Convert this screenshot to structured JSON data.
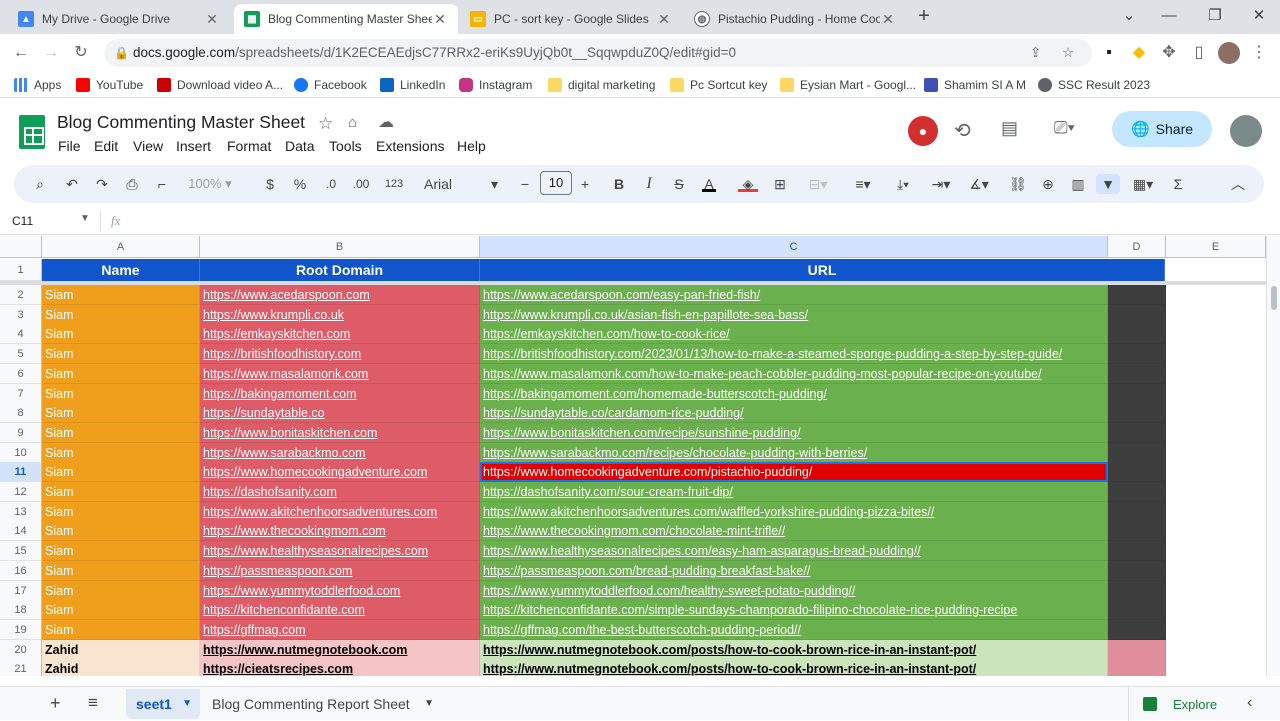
{
  "browser": {
    "tabs": [
      {
        "title": "My Drive - Google Drive",
        "icon": "google-drive-icon",
        "color": "#4285f4"
      },
      {
        "title": "Blog Commenting Master Sheet",
        "icon": "google-sheets-icon",
        "color": "#0f9d58"
      },
      {
        "title": "PC - sort key - Google Slides",
        "icon": "google-slides-icon",
        "color": "#f4b400"
      },
      {
        "title": "Pistachio Pudding - Home Cooki",
        "icon": "web-icon",
        "color": "#5f6368"
      }
    ],
    "url_host": "docs.google.com",
    "url_path": "/spreadsheets/d/1K2ECEAEdjsC77RRx2-eriKs9UyjQb0t__SqqwpduZ0Q/edit#gid=0",
    "bookmarks": [
      {
        "label": "Apps",
        "color": "#4285f4"
      },
      {
        "label": "YouTube",
        "color": "#ff0000"
      },
      {
        "label": "Download video A...",
        "color": "#cc0000"
      },
      {
        "label": "Facebook",
        "color": "#1877f2"
      },
      {
        "label": "LinkedIn",
        "color": "#0a66c2"
      },
      {
        "label": "Instagram",
        "color": "#c13584"
      },
      {
        "label": "digital marketing",
        "color": "#fdd663"
      },
      {
        "label": "Pc Sortcut  key",
        "color": "#fdd663"
      },
      {
        "label": "Eysian Mart - Googl...",
        "color": "#fdd663"
      },
      {
        "label": "Shamim SI A M",
        "color": "#3f51b5"
      },
      {
        "label": "SSC Result 2023",
        "color": "#5f6368"
      }
    ]
  },
  "doc": {
    "title": "Blog Commenting Master Sheet",
    "menus": [
      "File",
      "Edit",
      "View",
      "Insert",
      "Format",
      "Data",
      "Tools",
      "Extensions",
      "Help"
    ],
    "share_label": "Share"
  },
  "toolbar": {
    "zoom": "100%",
    "currency": "$",
    "percent": "%",
    "dec_decrease": ".0",
    "dec_increase": ".00",
    "number_format": "123",
    "font": "Arial",
    "font_size": "10",
    "bold": "B",
    "italic": "I",
    "strike": "S",
    "text_color": "A"
  },
  "formula_bar": {
    "cell_ref": "C11",
    "fx": "fx",
    "content": ""
  },
  "sheet": {
    "columns": [
      "A",
      "B",
      "C",
      "D",
      "E"
    ],
    "header_row_num": "1",
    "headers": [
      "Name",
      "Root Domain",
      "URL"
    ],
    "selected_row": "11",
    "rows": [
      {
        "n": "2",
        "name": "Siam",
        "domain": "https://www.acedarspoon.com",
        "url": "https://www.acedarspoon.com/easy-pan-fried-fish/"
      },
      {
        "n": "3",
        "name": "Siam",
        "domain": "https://www.krumpli.co.uk",
        "url": "https://www.krumpli.co.uk/asian-fish-en-papillote-sea-bass/"
      },
      {
        "n": "4",
        "name": "Siam",
        "domain": "https://emkayskitchen.com",
        "url": "https://emkayskitchen.com/how-to-cook-rice/"
      },
      {
        "n": "5",
        "name": "Siam",
        "domain": "https://britishfoodhistory.com",
        "url": "https://britishfoodhistory.com/2023/01/13/how-to-make-a-steamed-sponge-pudding-a-step-by-step-guide/"
      },
      {
        "n": "6",
        "name": "Siam",
        "domain": "https://www.masalamonk.com",
        "url": "https://www.masalamonk.com/how-to-make-peach-cobbler-pudding-most-popular-recipe-on-youtube/"
      },
      {
        "n": "7",
        "name": "Siam",
        "domain": "https://bakingamoment.com",
        "url": "https://bakingamoment.com/homemade-butterscotch-pudding/"
      },
      {
        "n": "8",
        "name": "Siam",
        "domain": "https://sundaytable.co",
        "url": "https://sundaytable.co/cardamom-rice-pudding/"
      },
      {
        "n": "9",
        "name": "Siam",
        "domain": "https://www.bonitaskitchen.com",
        "url": "https://www.bonitaskitchen.com/recipe/sunshine-pudding/"
      },
      {
        "n": "10",
        "name": "Siam",
        "domain": "https://www.sarabackmo.com",
        "url": "https://www.sarabackmo.com/recipes/chocolate-pudding-with-berries/"
      },
      {
        "n": "11",
        "name": "Siam",
        "domain": "https://www.homecookingadventure.com",
        "url": "https://www.homecookingadventure.com/pistachio-pudding/"
      },
      {
        "n": "12",
        "name": "Siam",
        "domain": "https://dashofsanity.com",
        "url": "https://dashofsanity.com/sour-cream-fruit-dip/"
      },
      {
        "n": "13",
        "name": "Siam",
        "domain": "https://www.akitchenhoorsadventures.com",
        "url": "https://www.akitchenhoorsadventures.com/waffled-yorkshire-pudding-pizza-bites//"
      },
      {
        "n": "14",
        "name": "Siam",
        "domain": "https://www.thecookingmom.com",
        "url": "https://www.thecookingmom.com/chocolate-mint-trifle//"
      },
      {
        "n": "15",
        "name": "Siam",
        "domain": "https://www.healthyseasonalrecipes.com",
        "url": "https://www.healthyseasonalrecipes.com/easy-ham-asparagus-bread-pudding//"
      },
      {
        "n": "16",
        "name": "Siam",
        "domain": "https://passmeaspoon.com",
        "url": "https://passmeaspoon.com/bread-pudding-breakfast-bake//"
      },
      {
        "n": "17",
        "name": "Siam",
        "domain": "https://www.yummytoddlerfood.com",
        "url": "https://www.yummytoddlerfood.com/healthy-sweet-potato-pudding//"
      },
      {
        "n": "18",
        "name": "Siam",
        "domain": "https://kitchenconfidante.com",
        "url": "https://kitchenconfidante.com/simple-sundays-champorado-filipino-chocolate-rice-pudding-recipe"
      },
      {
        "n": "19",
        "name": "Siam",
        "domain": "https://gffmag.com",
        "url": "https://gffmag.com/the-best-butterscotch-pudding-period//"
      },
      {
        "n": "20",
        "name": "Zahid",
        "domain": "https://www.nutmegnotebook.com",
        "url": "https://www.nutmegnotebook.com/posts/how-to-cook-brown-rice-in-an-instant-pot/"
      },
      {
        "n": "21",
        "name": "Zahid",
        "domain": "https://cieatsrecipes.com",
        "url": "https://www.nutmegnotebook.com/posts/how-to-cook-brown-rice-in-an-instant-pot/"
      }
    ]
  },
  "bottom": {
    "sheets": [
      "seet1",
      "Blog Commenting Report Sheet"
    ],
    "explore": "Explore"
  },
  "colors": {
    "header_blue": "#1155cc",
    "siam_name": "#f09f1c",
    "siam_domain": "#dd5c67",
    "siam_url": "#6ab04c",
    "col_d": "#3d3d3d",
    "zahid_name": "#f9e5cf",
    "zahid_domain": "#f4c4c6",
    "zahid_url": "#cce4bc",
    "zahid_d": "#e08f9a",
    "selected_url_bg": "#e00000"
  }
}
